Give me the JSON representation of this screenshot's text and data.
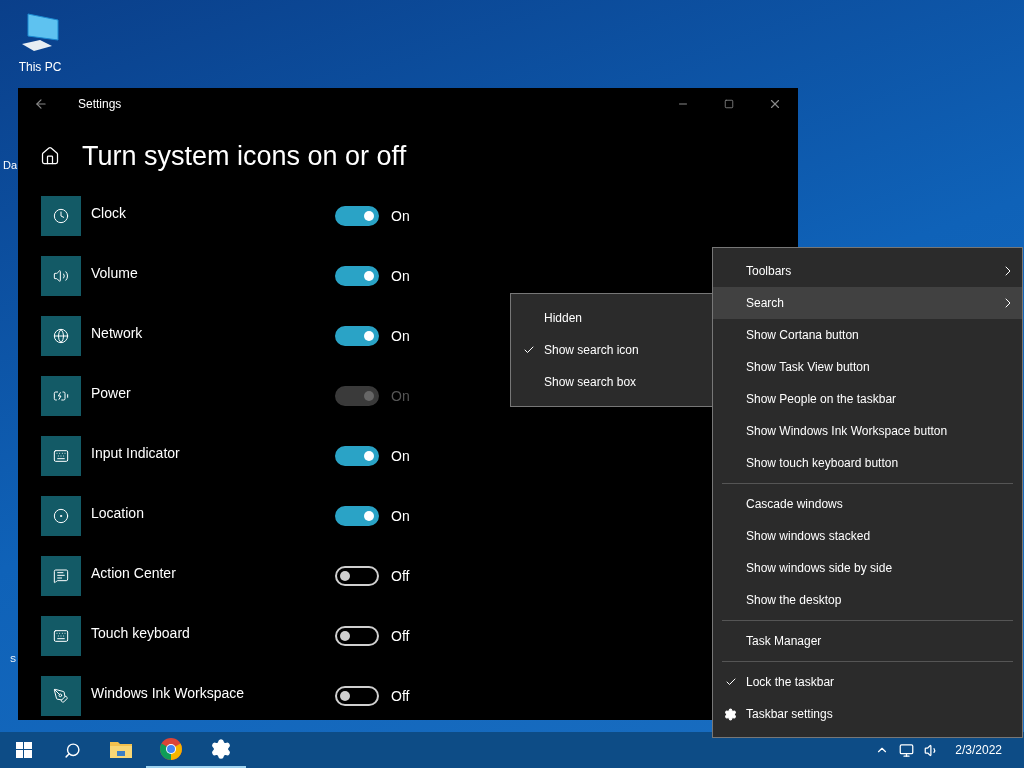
{
  "desktop": {
    "icons": [
      {
        "label": "This PC"
      }
    ],
    "cut_labels": [
      "Da",
      "S"
    ]
  },
  "window": {
    "title": "Settings",
    "heading": "Turn system icons on or off",
    "settings": [
      {
        "name": "Clock",
        "on": true,
        "disabled": false,
        "state": "On"
      },
      {
        "name": "Volume",
        "on": true,
        "disabled": false,
        "state": "On"
      },
      {
        "name": "Network",
        "on": true,
        "disabled": false,
        "state": "On"
      },
      {
        "name": "Power",
        "on": true,
        "disabled": true,
        "state": "On"
      },
      {
        "name": "Input Indicator",
        "on": true,
        "disabled": false,
        "state": "On"
      },
      {
        "name": "Location",
        "on": true,
        "disabled": false,
        "state": "On"
      },
      {
        "name": "Action Center",
        "on": false,
        "disabled": false,
        "state": "Off"
      },
      {
        "name": "Touch keyboard",
        "on": false,
        "disabled": false,
        "state": "Off"
      },
      {
        "name": "Windows Ink Workspace",
        "on": false,
        "disabled": false,
        "state": "Off"
      }
    ]
  },
  "context_menu": {
    "groups": [
      [
        {
          "label": "Toolbars",
          "submenu": true,
          "selected": false,
          "checked": false
        },
        {
          "label": "Search",
          "submenu": true,
          "selected": true,
          "checked": false
        },
        {
          "label": "Show Cortana button",
          "submenu": false,
          "selected": false,
          "checked": false
        },
        {
          "label": "Show Task View button",
          "submenu": false,
          "selected": false,
          "checked": false
        },
        {
          "label": "Show People on the taskbar",
          "submenu": false,
          "selected": false,
          "checked": false
        },
        {
          "label": "Show Windows Ink Workspace button",
          "submenu": false,
          "selected": false,
          "checked": false
        },
        {
          "label": "Show touch keyboard button",
          "submenu": false,
          "selected": false,
          "checked": false
        }
      ],
      [
        {
          "label": "Cascade windows",
          "submenu": false,
          "selected": false,
          "checked": false
        },
        {
          "label": "Show windows stacked",
          "submenu": false,
          "selected": false,
          "checked": false
        },
        {
          "label": "Show windows side by side",
          "submenu": false,
          "selected": false,
          "checked": false
        },
        {
          "label": "Show the desktop",
          "submenu": false,
          "selected": false,
          "checked": false
        }
      ],
      [
        {
          "label": "Task Manager",
          "submenu": false,
          "selected": false,
          "checked": false
        }
      ],
      [
        {
          "label": "Lock the taskbar",
          "submenu": false,
          "selected": false,
          "checked": true,
          "kind": "check"
        },
        {
          "label": "Taskbar settings",
          "submenu": false,
          "selected": false,
          "checked": false,
          "kind": "settings"
        }
      ]
    ]
  },
  "search_submenu": [
    {
      "label": "Hidden",
      "checked": false
    },
    {
      "label": "Show search icon",
      "checked": true
    },
    {
      "label": "Show search box",
      "checked": false
    }
  ],
  "taskbar": {
    "apps": [
      {
        "kind": "explorer",
        "running": false
      },
      {
        "kind": "chrome",
        "running": true
      },
      {
        "kind": "settings",
        "running": true
      }
    ],
    "date": "2/3/2022"
  }
}
